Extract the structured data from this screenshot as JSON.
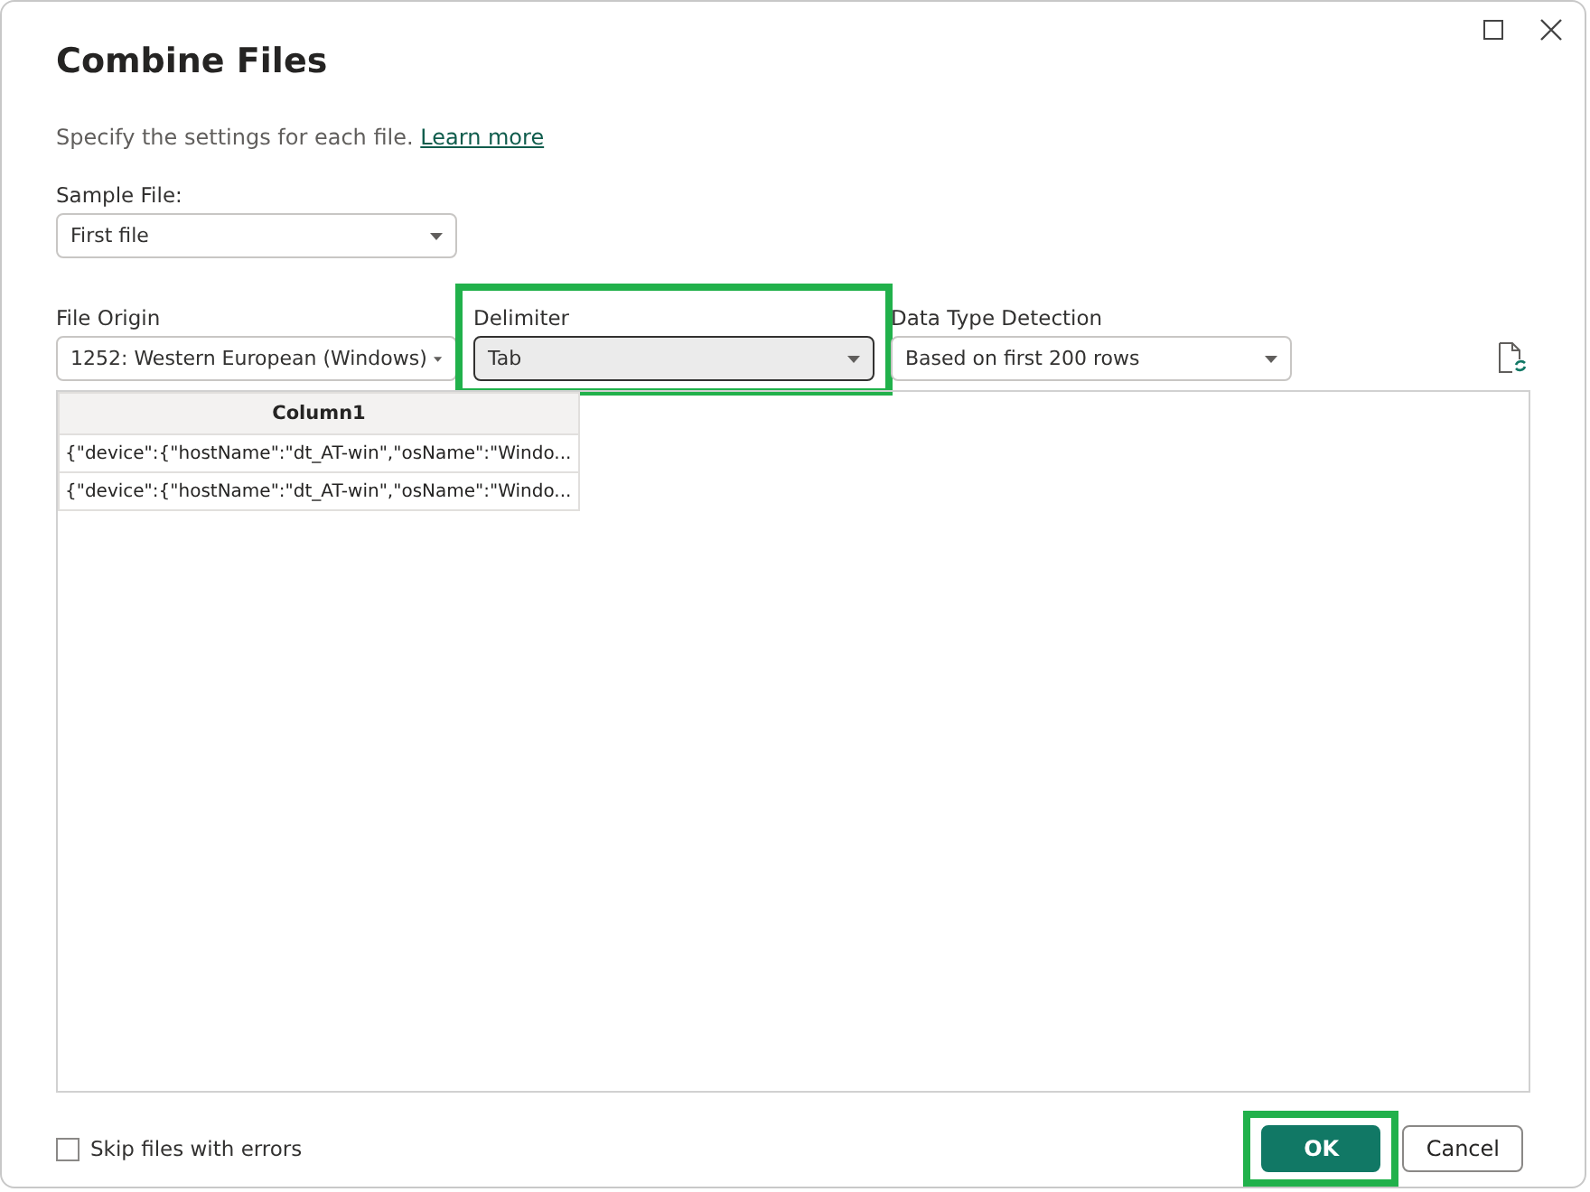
{
  "window": {
    "title": "Combine Files",
    "controls": [
      {
        "kind": "maximize"
      },
      {
        "kind": "close"
      }
    ]
  },
  "description": {
    "text": "Specify the settings for each file.",
    "link": "Learn more"
  },
  "sample_file": {
    "label": "Sample File:",
    "value": "First file"
  },
  "settings": [
    {
      "label": "File Origin",
      "value": "1252: Western European (Windows)",
      "highlighted": false,
      "focused": false
    },
    {
      "label": "Delimiter",
      "value": "Tab",
      "highlighted": true,
      "focused": true
    },
    {
      "label": "Data Type Detection",
      "value": "Based on first 200 rows",
      "highlighted": false,
      "focused": false
    }
  ],
  "preview": {
    "columns": [
      "Column1"
    ],
    "rows": [
      [
        "{\"device\":{\"hostName\":\"dt_AT-win\",\"osName\":\"Windo..."
      ],
      [
        "{\"device\":{\"hostName\":\"dt_AT-win\",\"osName\":\"Windo..."
      ]
    ]
  },
  "skip_errors": {
    "label": "Skip files with errors",
    "checked": false
  },
  "buttons": [
    {
      "label": "OK",
      "kind": "primary",
      "highlighted": true
    },
    {
      "label": "Cancel",
      "kind": "secondary",
      "highlighted": false
    }
  ]
}
